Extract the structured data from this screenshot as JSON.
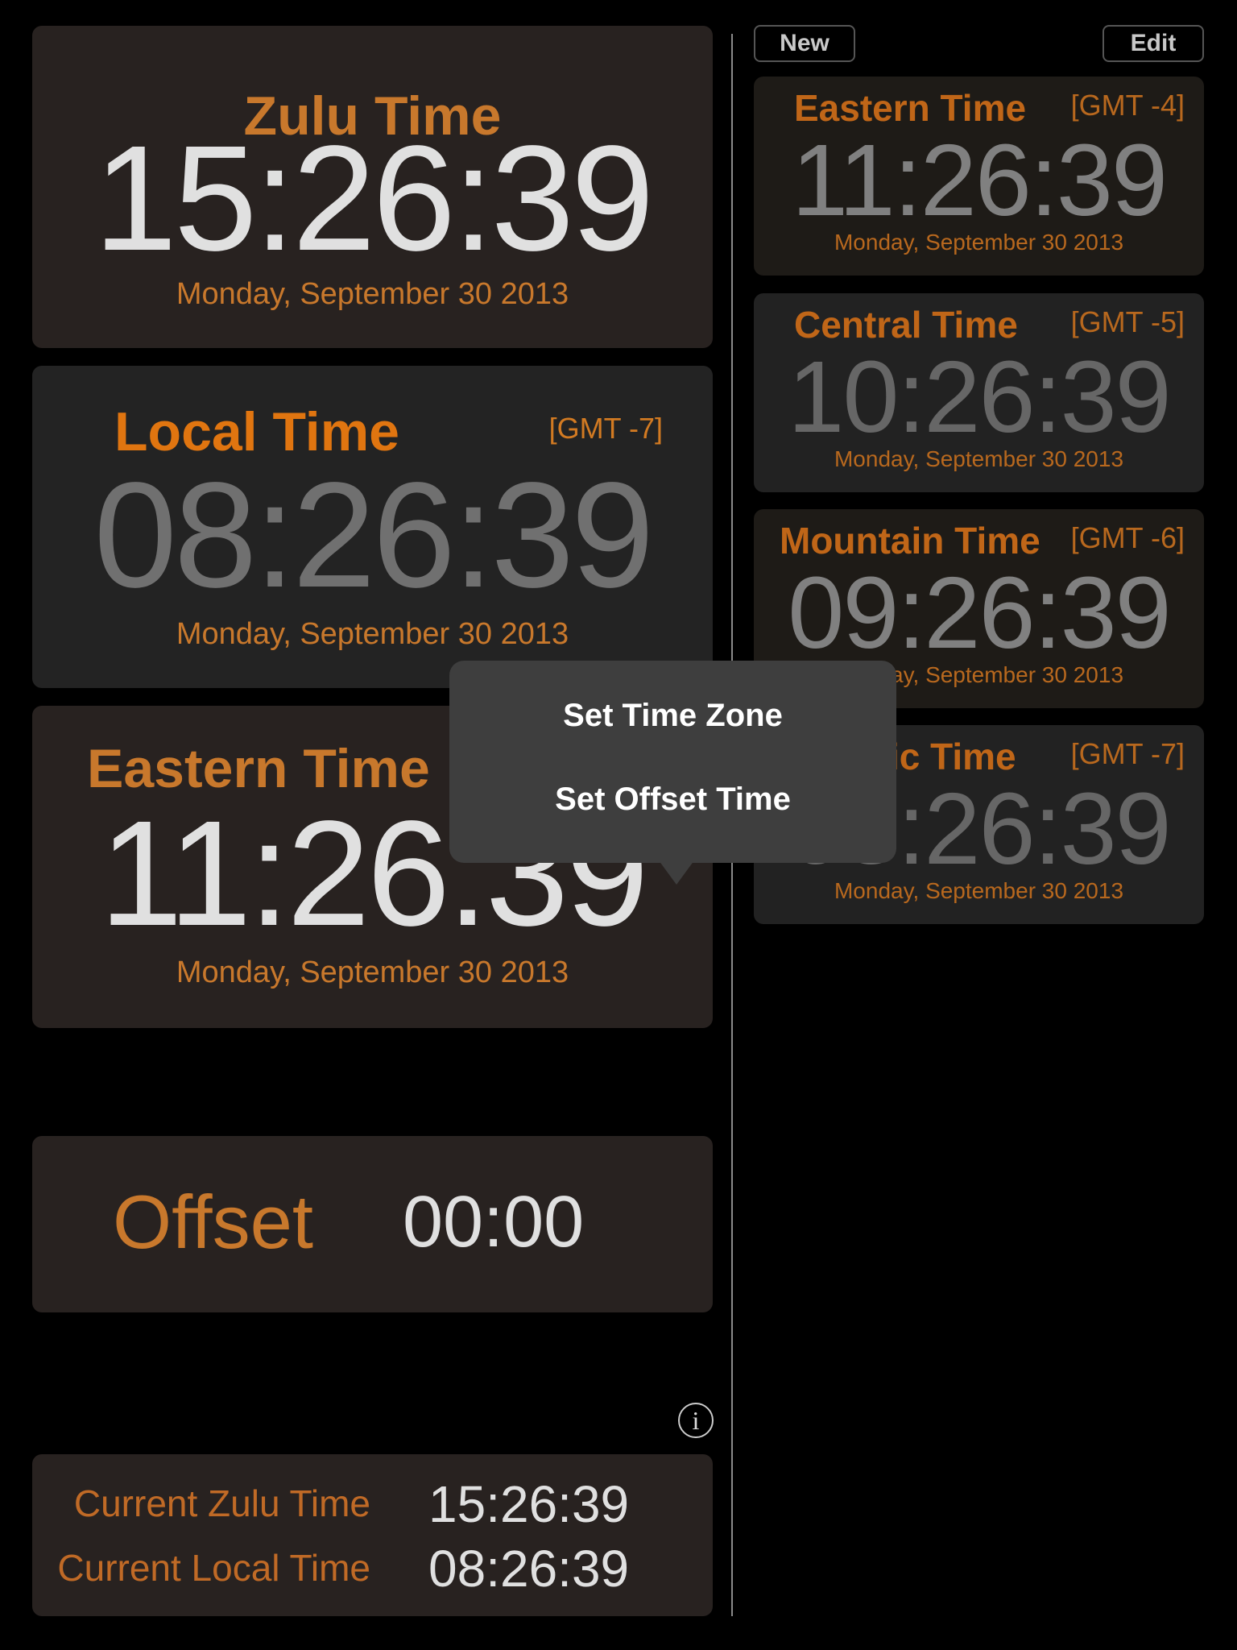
{
  "toolbar": {
    "new_label": "New",
    "edit_label": "Edit"
  },
  "main_clocks": [
    {
      "title": "Zulu Time",
      "gmt": "",
      "time": "15:26:39",
      "date": "Monday, September 30 2013"
    },
    {
      "title": "Local Time",
      "gmt": "[GMT -7]",
      "time": "08:26:39",
      "date": "Monday, September 30 2013"
    },
    {
      "title": "Eastern Time",
      "gmt": "",
      "time": "11:26:39",
      "date": "Monday, September 30 2013"
    }
  ],
  "offset": {
    "label": "Offset",
    "value": "00:00"
  },
  "info_icon": "info-icon",
  "current": {
    "zulu_label": "Current Zulu Time",
    "zulu_value": "15:26:39",
    "local_label": "Current Local Time",
    "local_value": "08:26:39"
  },
  "zones": [
    {
      "title": "Eastern Time",
      "gmt": "[GMT -4]",
      "time": "11:26:39",
      "date": "Monday, September 30 2013"
    },
    {
      "title": "Central Time",
      "gmt": "[GMT -5]",
      "time": "10:26:39",
      "date": "Monday, September 30 2013"
    },
    {
      "title": "Mountain Time",
      "gmt": "[GMT -6]",
      "time": "09:26:39",
      "date": "Monday, September 30 2013"
    },
    {
      "title": "Pacific Time",
      "gmt": "[GMT -7]",
      "time": "08:26:39",
      "date": "Monday, September 30 2013"
    }
  ],
  "popover": {
    "items": [
      "Set Time Zone",
      "Set Offset Time"
    ]
  },
  "colors": {
    "accent_orange": "#c8782c",
    "card_bg": "#282220",
    "popover_bg": "#3e3e3e"
  }
}
